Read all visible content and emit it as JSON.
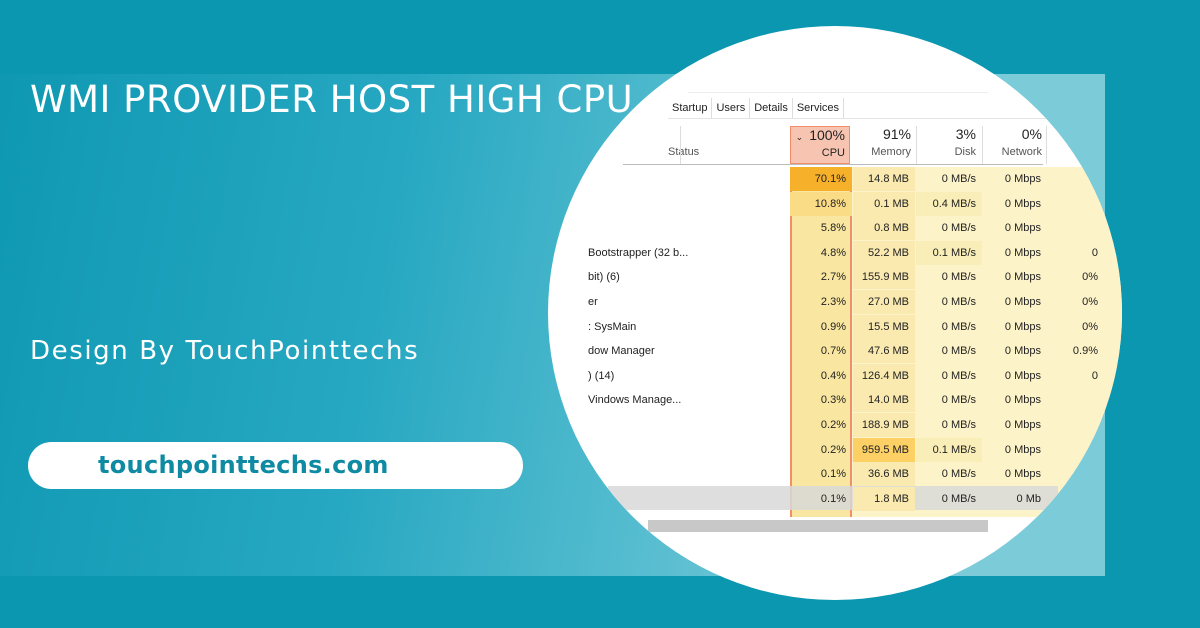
{
  "headline": "WMI PROVIDER HOST HIGH CPU",
  "credit": "Design By TouchPointtechs",
  "url_button": "touchpointtechs.com",
  "colors": {
    "brand_teal": "#0c97b1",
    "cpu_highlight": "#f5a623",
    "memory_highlight": "#fdd36a"
  },
  "task_manager": {
    "tabs": [
      "Startup",
      "Users",
      "Details",
      "Services"
    ],
    "columns": [
      {
        "label": "Status",
        "value": ""
      },
      {
        "label": "CPU",
        "value": "100%",
        "sorted": true
      },
      {
        "label": "Memory",
        "value": "91%"
      },
      {
        "label": "Disk",
        "value": "3%"
      },
      {
        "label": "Network",
        "value": "0%"
      }
    ],
    "rows": [
      {
        "name": "",
        "cpu": "70.1%",
        "memory": "14.8 MB",
        "disk": "0 MB/s",
        "network": "0 Mbps",
        "extra": ""
      },
      {
        "name": "",
        "cpu": "10.8%",
        "memory": "0.1 MB",
        "disk": "0.4 MB/s",
        "network": "0 Mbps",
        "extra": ""
      },
      {
        "name": "",
        "cpu": "5.8%",
        "memory": "0.8 MB",
        "disk": "0 MB/s",
        "network": "0 Mbps",
        "extra": ""
      },
      {
        "name": "Bootstrapper (32 b...",
        "cpu": "4.8%",
        "memory": "52.2 MB",
        "disk": "0.1 MB/s",
        "network": "0 Mbps",
        "extra": "0"
      },
      {
        "name": "bit) (6)",
        "cpu": "2.7%",
        "memory": "155.9 MB",
        "disk": "0 MB/s",
        "network": "0 Mbps",
        "extra": "0%"
      },
      {
        "name": "er",
        "cpu": "2.3%",
        "memory": "27.0 MB",
        "disk": "0 MB/s",
        "network": "0 Mbps",
        "extra": "0%"
      },
      {
        "name": ": SysMain",
        "cpu": "0.9%",
        "memory": "15.5 MB",
        "disk": "0 MB/s",
        "network": "0 Mbps",
        "extra": "0%"
      },
      {
        "name": "dow Manager",
        "cpu": "0.7%",
        "memory": "47.6 MB",
        "disk": "0 MB/s",
        "network": "0 Mbps",
        "extra": "0.9%"
      },
      {
        "name": ") (14)",
        "cpu": "0.4%",
        "memory": "126.4 MB",
        "disk": "0 MB/s",
        "network": "0 Mbps",
        "extra": "0"
      },
      {
        "name": "Vindows Manage...",
        "cpu": "0.3%",
        "memory": "14.0 MB",
        "disk": "0 MB/s",
        "network": "0 Mbps",
        "extra": ""
      },
      {
        "name": "",
        "cpu": "0.2%",
        "memory": "188.9 MB",
        "disk": "0 MB/s",
        "network": "0 Mbps",
        "extra": ""
      },
      {
        "name": "",
        "cpu": "0.2%",
        "memory": "959.5 MB",
        "disk": "0.1 MB/s",
        "network": "0 Mbps",
        "extra": ""
      },
      {
        "name": "",
        "cpu": "0.1%",
        "memory": "36.6 MB",
        "disk": "0 MB/s",
        "network": "0 Mbps",
        "extra": ""
      },
      {
        "name": "",
        "cpu": "0.1%",
        "memory": "1.8 MB",
        "disk": "0 MB/s",
        "network": "0 Mb",
        "extra": ""
      }
    ]
  }
}
